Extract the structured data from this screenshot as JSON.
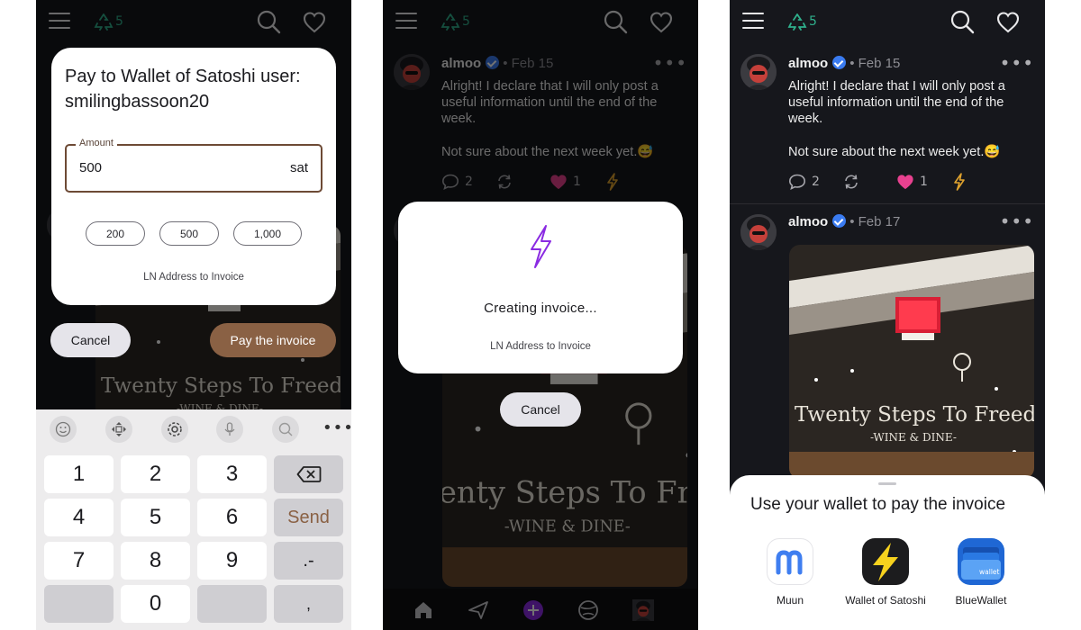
{
  "colors": {
    "accent_brown": "#8a6144",
    "verified": "#3a7bf0",
    "heart": "#e8418f",
    "zap": "#e0a32e",
    "badge_green": "#2fb08c",
    "bolt_purple": "#8a2be2"
  },
  "topbar": {
    "badge_count": "5",
    "icons": [
      "menu-icon",
      "recycle-icon",
      "search-icon",
      "heart-icon"
    ]
  },
  "posts": [
    {
      "author": "almoo",
      "date": "• Feb 15",
      "text": [
        "Alright! I declare that I will only post a useful information until the end of the week.",
        "Not sure about the next week yet.😅"
      ],
      "replies": "2",
      "likes": "1"
    },
    {
      "author": "almoo",
      "date": "• Feb 17"
    }
  ],
  "pay_dialog": {
    "title": "Pay to Wallet of Satoshi user: smilingbassoon20",
    "amount_label": "Amount",
    "amount_value": "500",
    "unit": "sat",
    "presets": [
      "200",
      "500",
      "1,000"
    ],
    "footer": "LN Address to Invoice",
    "cancel": "Cancel",
    "pay": "Pay the invoice"
  },
  "keyboard": {
    "keys": [
      "1",
      "2",
      "3",
      "4",
      "5",
      "6",
      "Send",
      "7",
      "8",
      "9",
      ".-",
      "0",
      ","
    ]
  },
  "invoice_dialog": {
    "message": "Creating invoice...",
    "footer": "LN Address to Invoice",
    "cancel": "Cancel"
  },
  "wallet_sheet": {
    "title": "Use your wallet to pay the invoice",
    "wallets": [
      {
        "name": "Muun",
        "icon": "muun-icon"
      },
      {
        "name": "Wallet of Satoshi",
        "icon": "wallet-of-satoshi-icon"
      },
      {
        "name": "BlueWallet",
        "icon": "bluewallet-icon",
        "icon_text": "wallet"
      }
    ]
  }
}
